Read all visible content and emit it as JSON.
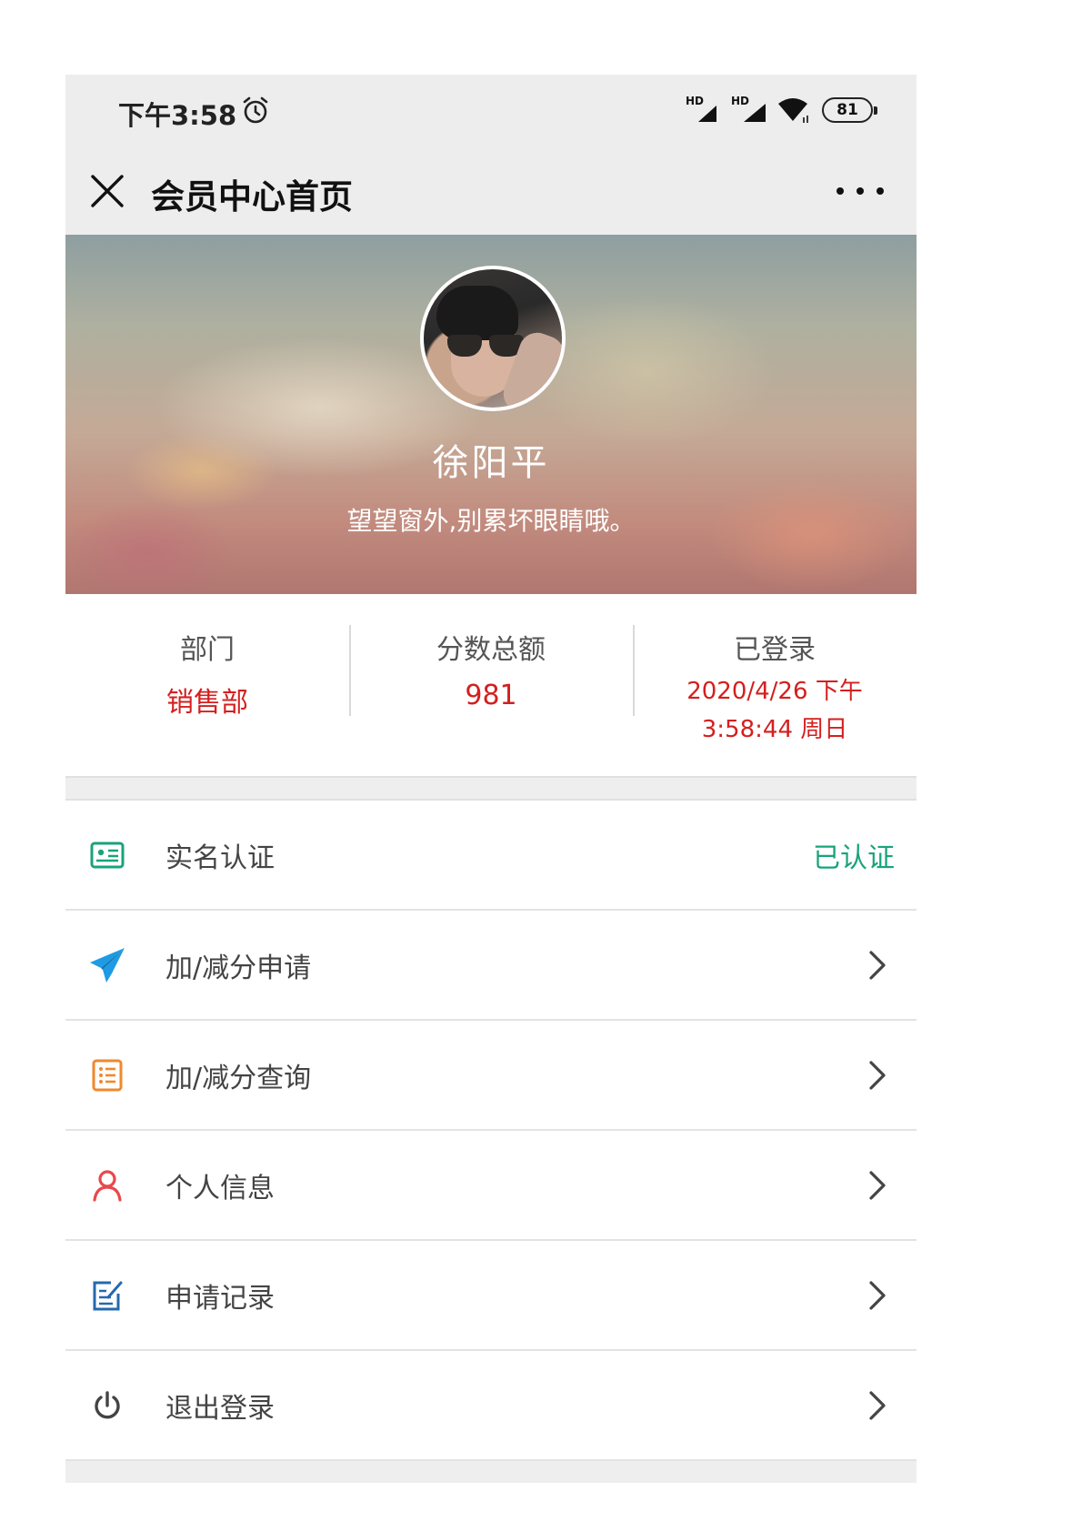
{
  "status_bar": {
    "time": "下午3:58",
    "signal_label": "HD",
    "battery": "81"
  },
  "nav": {
    "title": "会员中心首页"
  },
  "profile": {
    "name": "徐阳平",
    "motto": "望望窗外,别累坏眼睛哦。"
  },
  "stats": {
    "department_label": "部门",
    "department_value": "销售部",
    "score_label": "分数总额",
    "score_value": "981",
    "login_label": "已登录",
    "login_line1": "2020/4/26 下午",
    "login_line2": "3:58:44 周日"
  },
  "menu": {
    "items": [
      {
        "label": "实名认证",
        "status": "已认证",
        "icon": "id-card-icon",
        "color": "#19a37a"
      },
      {
        "label": "加/减分申请",
        "icon": "paper-plane-icon",
        "color": "#1e9be4"
      },
      {
        "label": "加/减分查询",
        "icon": "list-icon",
        "color": "#f0892b"
      },
      {
        "label": "个人信息",
        "icon": "person-icon",
        "color": "#e8484c"
      },
      {
        "label": "申请记录",
        "icon": "edit-record-icon",
        "color": "#2469b0"
      },
      {
        "label": "退出登录",
        "icon": "power-icon",
        "color": "#444444"
      }
    ]
  },
  "colors": {
    "accent_red": "#d41f1f",
    "verified_green": "#19a37a",
    "bar_gray": "#ededed"
  }
}
